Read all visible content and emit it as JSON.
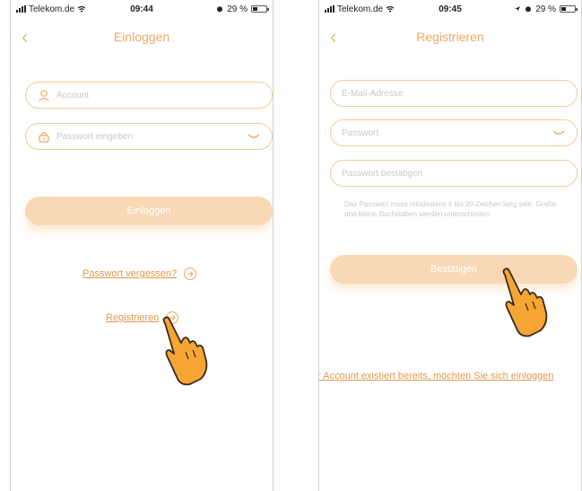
{
  "left": {
    "status": {
      "carrier": "Telekom.de",
      "time": "09:44",
      "battery": "29 %"
    },
    "title": "Einloggen",
    "account_placeholder": "Account",
    "password_placeholder": "Passwort eingeben",
    "login_button": "Einloggen",
    "forgot_link": "Passwort vergessen?",
    "register_link": "Registrieren"
  },
  "right": {
    "status": {
      "carrier": "Telekom.de",
      "time": "09:45",
      "battery": "29 %"
    },
    "title": "Registrieren",
    "email_placeholder": "E-Mail-Adresse",
    "password_placeholder": "Passwort",
    "confirm_placeholder": "Passwort bestätigen",
    "hint": "Das Passwort muss mindestens 6 bis 20 Zeichen lang sein. Große und kleine Buchstaben werden unterschieden.",
    "confirm_button": "Bestätigen",
    "existing_link": "r Account existiert bereits, möchten Sie sich einloggen"
  },
  "colors": {
    "accent": "#f0a860",
    "field_border": "#f6c99b",
    "button_fill": "#f8d8b5",
    "hand": "#f4a533"
  },
  "icons": [
    "wifi-icon",
    "alarm-icon",
    "user-icon",
    "lock-icon",
    "eye-hidden-icon",
    "arrow-circle-icon",
    "hand-pointer-icon"
  ]
}
